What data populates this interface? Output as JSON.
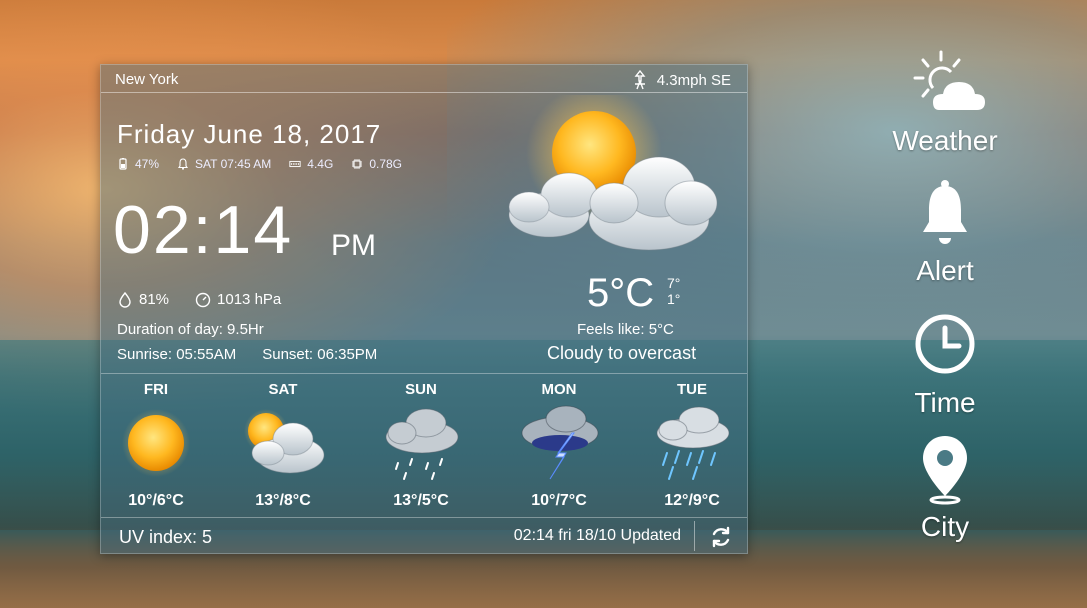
{
  "location": {
    "city": "New York",
    "wind": "4.3mph SE"
  },
  "date": "Friday June 18, 2017",
  "stats": {
    "battery": "47%",
    "alarm": "SAT 07:45 AM",
    "ram": "4.4G",
    "cpu": "0.78G"
  },
  "clock": {
    "time": "02:14",
    "ampm": "PM"
  },
  "humidity": "81%",
  "pressure": "1013 hPa",
  "duration": "Duration of day: 9.5Hr",
  "sunrise": "Sunrise: 05:55AM",
  "sunset": "Sunset: 06:35PM",
  "current": {
    "temp": "5°C",
    "high": "7°",
    "low": "1°",
    "feels": "Feels like:  5°C",
    "condition": "Cloudy to overcast",
    "icon": "sun-behind-cloud-icon"
  },
  "forecast": [
    {
      "day": "FRI",
      "temp": "10°/6°C",
      "icon": "sunny-icon"
    },
    {
      "day": "SAT",
      "temp": "13°/8°C",
      "icon": "partly-cloudy-icon"
    },
    {
      "day": "SUN",
      "temp": "13°/5°C",
      "icon": "light-rain-icon"
    },
    {
      "day": "MON",
      "temp": "10°/7°C",
      "icon": "thunderstorm-icon"
    },
    {
      "day": "TUE",
      "temp": "12°/9°C",
      "icon": "rain-icon"
    }
  ],
  "uv": "UV index: 5",
  "updated": "02:14 fri 18/10 Updated",
  "nav": [
    {
      "label": "Weather",
      "icon": "weather-icon"
    },
    {
      "label": "Alert",
      "icon": "bell-icon"
    },
    {
      "label": "Time",
      "icon": "clock-icon"
    },
    {
      "label": "City",
      "icon": "location-pin-icon"
    }
  ]
}
